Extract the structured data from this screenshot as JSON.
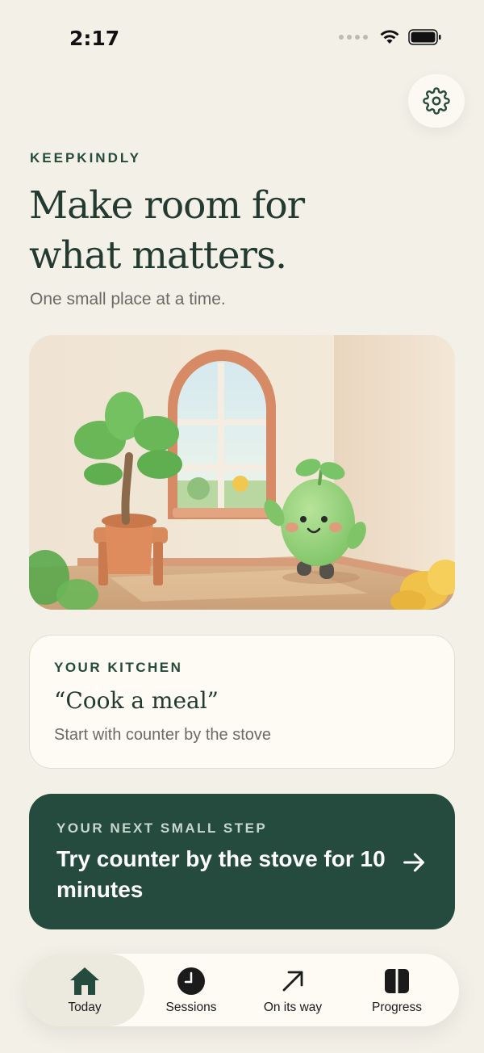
{
  "status_bar": {
    "time": "2:17"
  },
  "header": {
    "brand": "KEEPKINDLY",
    "headline": "Make room for what matters.",
    "subtitle": "One small place at a time."
  },
  "settings": {
    "icon": "gear-icon"
  },
  "room_card": {
    "label": "YOUR KITCHEN",
    "task": "“Cook a meal”",
    "hint": "Start with counter by the stove"
  },
  "next_step": {
    "label": "YOUR NEXT SMALL STEP",
    "title": "Try counter by the stove for 10 minutes",
    "icon": "arrow-right-icon"
  },
  "tabs": [
    {
      "label": "Today",
      "icon": "home-icon",
      "active": true
    },
    {
      "label": "Sessions",
      "icon": "clock-icon",
      "active": false
    },
    {
      "label": "On its way",
      "icon": "arrow-up-right-icon",
      "active": false
    },
    {
      "label": "Progress",
      "icon": "columns-icon",
      "active": false
    }
  ],
  "colors": {
    "background": "#f3f0e8",
    "accent": "#244b3e",
    "card": "#fdfbf4"
  }
}
